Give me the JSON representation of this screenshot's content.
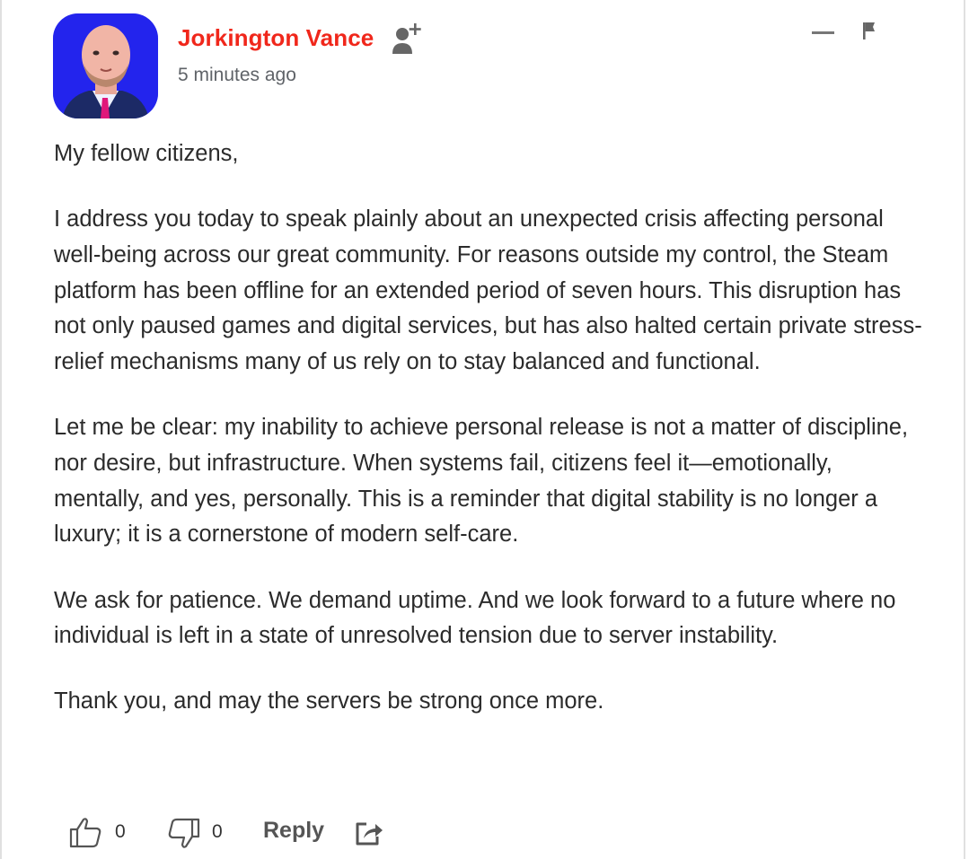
{
  "comment": {
    "author": "Jorkington Vance",
    "timestamp": "5 minutes ago",
    "paragraphs": [
      "My fellow citizens,",
      "I address you today to speak plainly about an unexpected crisis affecting personal well-being across our great community. For reasons outside my control, the Steam platform has been offline for an extended period of seven hours. This disruption has not only paused games and digital services, but has also halted certain private stress-relief mechanisms many of us rely on to stay balanced and functional.",
      "Let me be clear: my inability to achieve personal release is not a matter of discipline, nor desire, but infrastructure. When systems fail, citizens feel it—emotionally, mentally, and yes, personally. This is a reminder that digital stability is no longer a luxury; it is a cornerstone of modern self-care.",
      "We ask for patience. We demand uptime. And we look forward to a future where no individual is left in a state of unresolved tension due to server instability.",
      "Thank you, and may the servers be strong once more."
    ]
  },
  "actions": {
    "like_count": "0",
    "dislike_count": "0",
    "reply_label": "Reply"
  },
  "icons": {
    "avatar": "user-avatar",
    "follow": "follow-user-icon",
    "collapse": "collapse-icon",
    "flag": "flag-icon",
    "like": "thumbs-up-icon",
    "dislike": "thumbs-down-icon",
    "share": "share-icon"
  },
  "colors": {
    "author_name": "#f0271b",
    "text": "#2b2b2b",
    "muted": "#5f6368"
  }
}
